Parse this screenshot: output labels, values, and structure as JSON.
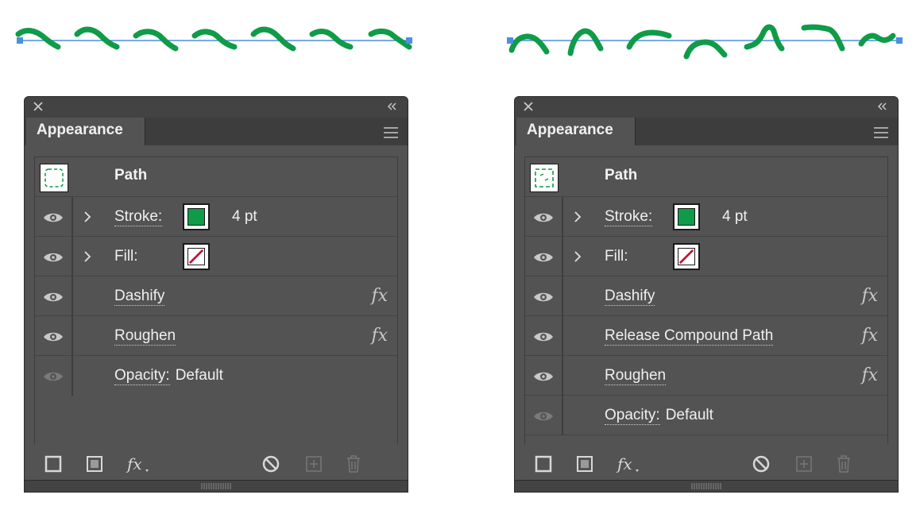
{
  "panels": [
    {
      "tab_label": "Appearance",
      "path_label": "Path",
      "stroke": {
        "label": "Stroke:",
        "weight": "4 pt",
        "color": "#0f9b48"
      },
      "fill": {
        "label": "Fill:",
        "state": "none"
      },
      "effects": [
        {
          "label": "Dashify",
          "fx": "fx"
        },
        {
          "label": "Roughen",
          "fx": "fx"
        }
      ],
      "opacity": {
        "label": "Opacity:",
        "value": "Default"
      }
    },
    {
      "tab_label": "Appearance",
      "path_label": "Path",
      "stroke": {
        "label": "Stroke:",
        "weight": "4 pt",
        "color": "#0f9b48"
      },
      "fill": {
        "label": "Fill:",
        "state": "none"
      },
      "effects": [
        {
          "label": "Dashify",
          "fx": "fx"
        },
        {
          "label": "Release Compound Path",
          "fx": "fx"
        },
        {
          "label": "Roughen",
          "fx": "fx"
        }
      ],
      "opacity": {
        "label": "Opacity:",
        "value": "Default"
      }
    }
  ],
  "footer_icons": [
    "stroke-square-icon",
    "fill-square-icon",
    "fx-menu-icon",
    "clear-appearance-icon",
    "duplicate-item-icon",
    "delete-item-icon"
  ],
  "colors": {
    "path_line": "#4a90e2",
    "stroke_green": "#0f9b48",
    "fill_none_red": "#c4122f",
    "panel_bg": "#535353"
  }
}
